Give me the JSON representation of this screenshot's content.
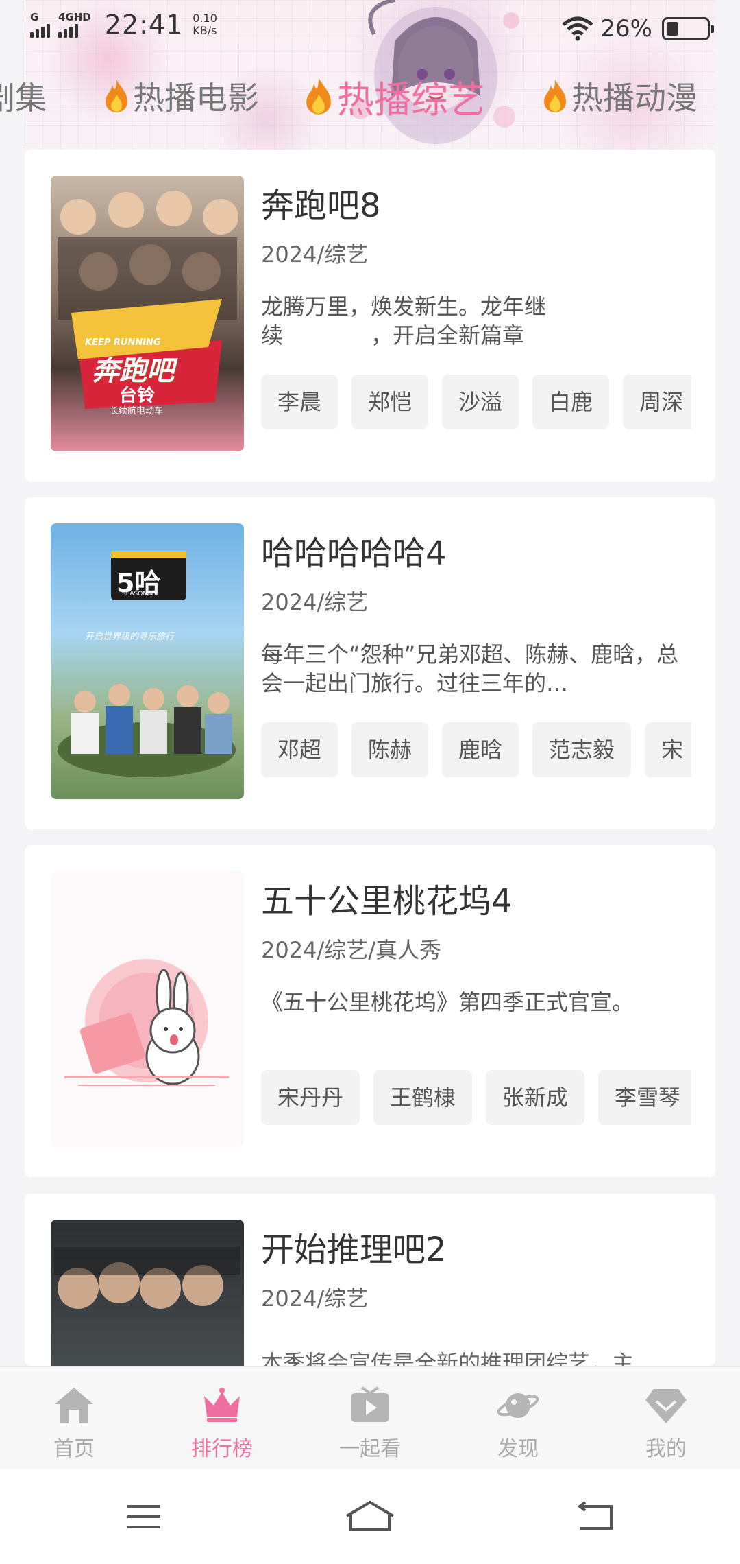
{
  "status_bar": {
    "sim1_label": "G",
    "sim2_label": "4GHD",
    "time": "22:41",
    "speed_value": "0.10",
    "speed_unit": "KB/s",
    "battery_pct": "26%",
    "battery_level": 0.26
  },
  "category_tabs": [
    {
      "label": "剧集",
      "active": false
    },
    {
      "label": "热播电影",
      "active": false
    },
    {
      "label": "热播综艺",
      "active": true
    },
    {
      "label": "热播动漫",
      "active": false
    }
  ],
  "shows": [
    {
      "title": "奔跑吧8",
      "meta": "2024/综艺",
      "desc": "龙腾万里，焕发新生。龙年继\n续　　　　，开启全新篇章",
      "cast": [
        "李晨",
        "郑恺",
        "沙溢",
        "白鹿",
        "周深"
      ],
      "poster_text": [
        "KEEP RUNNING",
        "奔跑吧",
        "台铃",
        "长续航电动车"
      ]
    },
    {
      "title": "哈哈哈哈哈4",
      "meta": "2024/综艺",
      "desc": "每年三个“怨种”兄弟邓超、陈赫、鹿晗，总会一起出门旅行。过往三年的…",
      "cast": [
        "邓超",
        "陈赫",
        "鹿晗",
        "范志毅",
        "宋"
      ],
      "poster_text": [
        "5哈",
        "SEASON 4",
        "开启世界级的寻乐旅行"
      ]
    },
    {
      "title": "五十公里桃花坞4",
      "meta": "2024/综艺/真人秀",
      "desc": "《五十公里桃花坞》第四季正式官宣。",
      "cast": [
        "宋丹丹",
        "王鹤棣",
        "张新成",
        "李雪琴"
      ]
    },
    {
      "title": "开始推理吧2",
      "meta": "2024/综艺",
      "desc": "本季将会宣传是全新的推理团综艺，主…",
      "cast": []
    }
  ],
  "bottom_nav": [
    {
      "label": "首页",
      "icon": "home-icon",
      "active": false
    },
    {
      "label": "排行榜",
      "icon": "crown-icon",
      "active": true
    },
    {
      "label": "一起看",
      "icon": "tv-play-icon",
      "active": false
    },
    {
      "label": "发现",
      "icon": "planet-icon",
      "active": false
    },
    {
      "label": "我的",
      "icon": "diamond-icon",
      "active": false
    }
  ],
  "colors": {
    "accent": "#ef6fa0",
    "inactive_text": "#aaaaaa",
    "tag_bg": "#f3f3f4"
  }
}
